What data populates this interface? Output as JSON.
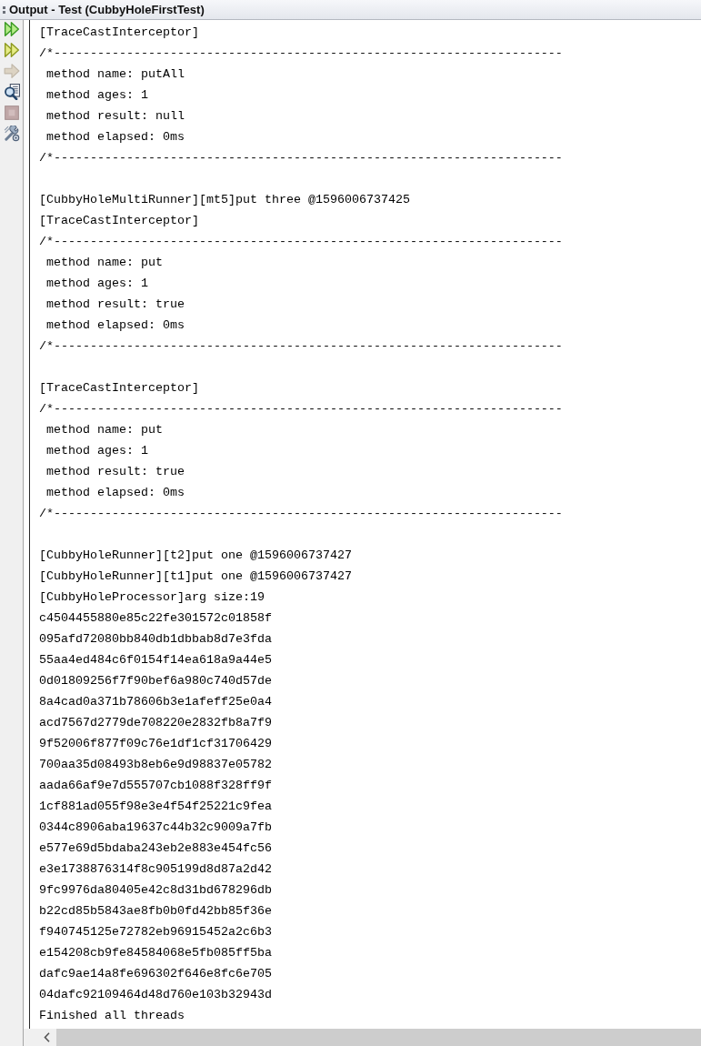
{
  "window": {
    "title": "Output - Test (CubbyHoleFirstTest)"
  },
  "toolbar": [
    {
      "kind": "rerun",
      "disabled": false
    },
    {
      "kind": "rerun_failed",
      "disabled": false
    },
    {
      "kind": "next",
      "disabled": true
    },
    {
      "kind": "find",
      "disabled": false
    },
    {
      "kind": "stop",
      "disabled": true
    },
    {
      "kind": "settings",
      "disabled": false
    }
  ],
  "console": {
    "blocks": [
      {
        "lines": [
          "[TraceCastInterceptor]",
          "/*----------------------------------------------------------------------",
          " method name: putAll",
          " method ages: 1",
          " method result: null",
          " method elapsed: 0ms",
          "/*----------------------------------------------------------------------"
        ]
      },
      {
        "lines": [
          "[CubbyHoleMultiRunner][mt5]put three @1596006737425",
          "[TraceCastInterceptor]",
          "/*----------------------------------------------------------------------",
          " method name: put",
          " method ages: 1",
          " method result: true",
          " method elapsed: 0ms",
          "/*----------------------------------------------------------------------"
        ]
      },
      {
        "lines": [
          "[TraceCastInterceptor]",
          "/*----------------------------------------------------------------------",
          " method name: put",
          " method ages: 1",
          " method result: true",
          " method elapsed: 0ms",
          "/*----------------------------------------------------------------------"
        ]
      },
      {
        "lines": [
          "[CubbyHoleRunner][t2]put one @1596006737427",
          "[CubbyHoleRunner][t1]put one @1596006737427",
          "[CubbyHoleProcessor]arg size:19",
          "c4504455880e85c22fe301572c01858f",
          "095afd72080bb840db1dbbab8d7e3fda",
          "55aa4ed484c6f0154f14ea618a9a44e5",
          "0d01809256f7f90bef6a980c740d57de",
          "8a4cad0a371b78606b3e1afeff25e0a4",
          "acd7567d2779de708220e2832fb8a7f9",
          "9f52006f877f09c76e1df1cf31706429",
          "700aa35d08493b8eb6e9d98837e05782",
          "aada66af9e7d555707cb1088f328ff9f",
          "1cf881ad055f98e3e4f54f25221c9fea",
          "0344c8906aba19637c44b32c9009a7fb",
          "e577e69d5bdaba243eb2e883e454fc56",
          "e3e1738876314f8c905199d8d87a2d42",
          "9fc9976da80405e42c8d31bd678296db",
          "b22cd85b5843ae8fb0b0fd42bb85f36e",
          "f940745125e72782eb96915452a2c6b3",
          "e154208cb9fe84584068e5fb085ff5ba",
          "dafc9ae14a8fe696302f646e8fc6e705",
          "04dafc92109464d48d760e103b32943d",
          "Finished all threads"
        ]
      }
    ]
  }
}
